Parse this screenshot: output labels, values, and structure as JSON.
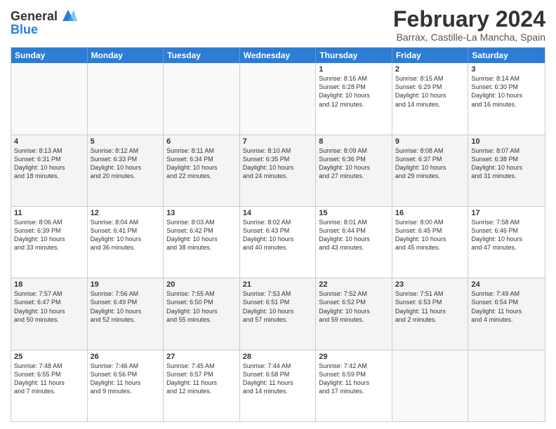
{
  "logo": {
    "line1": "General",
    "line2": "Blue"
  },
  "title": "February 2024",
  "location": "Barrax, Castille-La Mancha, Spain",
  "header_days": [
    "Sunday",
    "Monday",
    "Tuesday",
    "Wednesday",
    "Thursday",
    "Friday",
    "Saturday"
  ],
  "rows": [
    {
      "bg": "even",
      "cells": [
        {
          "date": "",
          "info": ""
        },
        {
          "date": "",
          "info": ""
        },
        {
          "date": "",
          "info": ""
        },
        {
          "date": "",
          "info": ""
        },
        {
          "date": "1",
          "info": "Sunrise: 8:16 AM\nSunset: 6:28 PM\nDaylight: 10 hours\nand 12 minutes."
        },
        {
          "date": "2",
          "info": "Sunrise: 8:15 AM\nSunset: 6:29 PM\nDaylight: 10 hours\nand 14 minutes."
        },
        {
          "date": "3",
          "info": "Sunrise: 8:14 AM\nSunset: 6:30 PM\nDaylight: 10 hours\nand 16 minutes."
        }
      ]
    },
    {
      "bg": "odd",
      "cells": [
        {
          "date": "4",
          "info": "Sunrise: 8:13 AM\nSunset: 6:31 PM\nDaylight: 10 hours\nand 18 minutes."
        },
        {
          "date": "5",
          "info": "Sunrise: 8:12 AM\nSunset: 6:33 PM\nDaylight: 10 hours\nand 20 minutes."
        },
        {
          "date": "6",
          "info": "Sunrise: 8:11 AM\nSunset: 6:34 PM\nDaylight: 10 hours\nand 22 minutes."
        },
        {
          "date": "7",
          "info": "Sunrise: 8:10 AM\nSunset: 6:35 PM\nDaylight: 10 hours\nand 24 minutes."
        },
        {
          "date": "8",
          "info": "Sunrise: 8:09 AM\nSunset: 6:36 PM\nDaylight: 10 hours\nand 27 minutes."
        },
        {
          "date": "9",
          "info": "Sunrise: 8:08 AM\nSunset: 6:37 PM\nDaylight: 10 hours\nand 29 minutes."
        },
        {
          "date": "10",
          "info": "Sunrise: 8:07 AM\nSunset: 6:38 PM\nDaylight: 10 hours\nand 31 minutes."
        }
      ]
    },
    {
      "bg": "even",
      "cells": [
        {
          "date": "11",
          "info": "Sunrise: 8:06 AM\nSunset: 6:39 PM\nDaylight: 10 hours\nand 33 minutes."
        },
        {
          "date": "12",
          "info": "Sunrise: 8:04 AM\nSunset: 6:41 PM\nDaylight: 10 hours\nand 36 minutes."
        },
        {
          "date": "13",
          "info": "Sunrise: 8:03 AM\nSunset: 6:42 PM\nDaylight: 10 hours\nand 38 minutes."
        },
        {
          "date": "14",
          "info": "Sunrise: 8:02 AM\nSunset: 6:43 PM\nDaylight: 10 hours\nand 40 minutes."
        },
        {
          "date": "15",
          "info": "Sunrise: 8:01 AM\nSunset: 6:44 PM\nDaylight: 10 hours\nand 43 minutes."
        },
        {
          "date": "16",
          "info": "Sunrise: 8:00 AM\nSunset: 6:45 PM\nDaylight: 10 hours\nand 45 minutes."
        },
        {
          "date": "17",
          "info": "Sunrise: 7:58 AM\nSunset: 6:46 PM\nDaylight: 10 hours\nand 47 minutes."
        }
      ]
    },
    {
      "bg": "odd",
      "cells": [
        {
          "date": "18",
          "info": "Sunrise: 7:57 AM\nSunset: 6:47 PM\nDaylight: 10 hours\nand 50 minutes."
        },
        {
          "date": "19",
          "info": "Sunrise: 7:56 AM\nSunset: 6:49 PM\nDaylight: 10 hours\nand 52 minutes."
        },
        {
          "date": "20",
          "info": "Sunrise: 7:55 AM\nSunset: 6:50 PM\nDaylight: 10 hours\nand 55 minutes."
        },
        {
          "date": "21",
          "info": "Sunrise: 7:53 AM\nSunset: 6:51 PM\nDaylight: 10 hours\nand 57 minutes."
        },
        {
          "date": "22",
          "info": "Sunrise: 7:52 AM\nSunset: 6:52 PM\nDaylight: 10 hours\nand 59 minutes."
        },
        {
          "date": "23",
          "info": "Sunrise: 7:51 AM\nSunset: 6:53 PM\nDaylight: 11 hours\nand 2 minutes."
        },
        {
          "date": "24",
          "info": "Sunrise: 7:49 AM\nSunset: 6:54 PM\nDaylight: 11 hours\nand 4 minutes."
        }
      ]
    },
    {
      "bg": "even",
      "cells": [
        {
          "date": "25",
          "info": "Sunrise: 7:48 AM\nSunset: 6:55 PM\nDaylight: 11 hours\nand 7 minutes."
        },
        {
          "date": "26",
          "info": "Sunrise: 7:46 AM\nSunset: 6:56 PM\nDaylight: 11 hours\nand 9 minutes."
        },
        {
          "date": "27",
          "info": "Sunrise: 7:45 AM\nSunset: 6:57 PM\nDaylight: 11 hours\nand 12 minutes."
        },
        {
          "date": "28",
          "info": "Sunrise: 7:44 AM\nSunset: 6:58 PM\nDaylight: 11 hours\nand 14 minutes."
        },
        {
          "date": "29",
          "info": "Sunrise: 7:42 AM\nSunset: 6:59 PM\nDaylight: 11 hours\nand 17 minutes."
        },
        {
          "date": "",
          "info": ""
        },
        {
          "date": "",
          "info": ""
        }
      ]
    }
  ]
}
